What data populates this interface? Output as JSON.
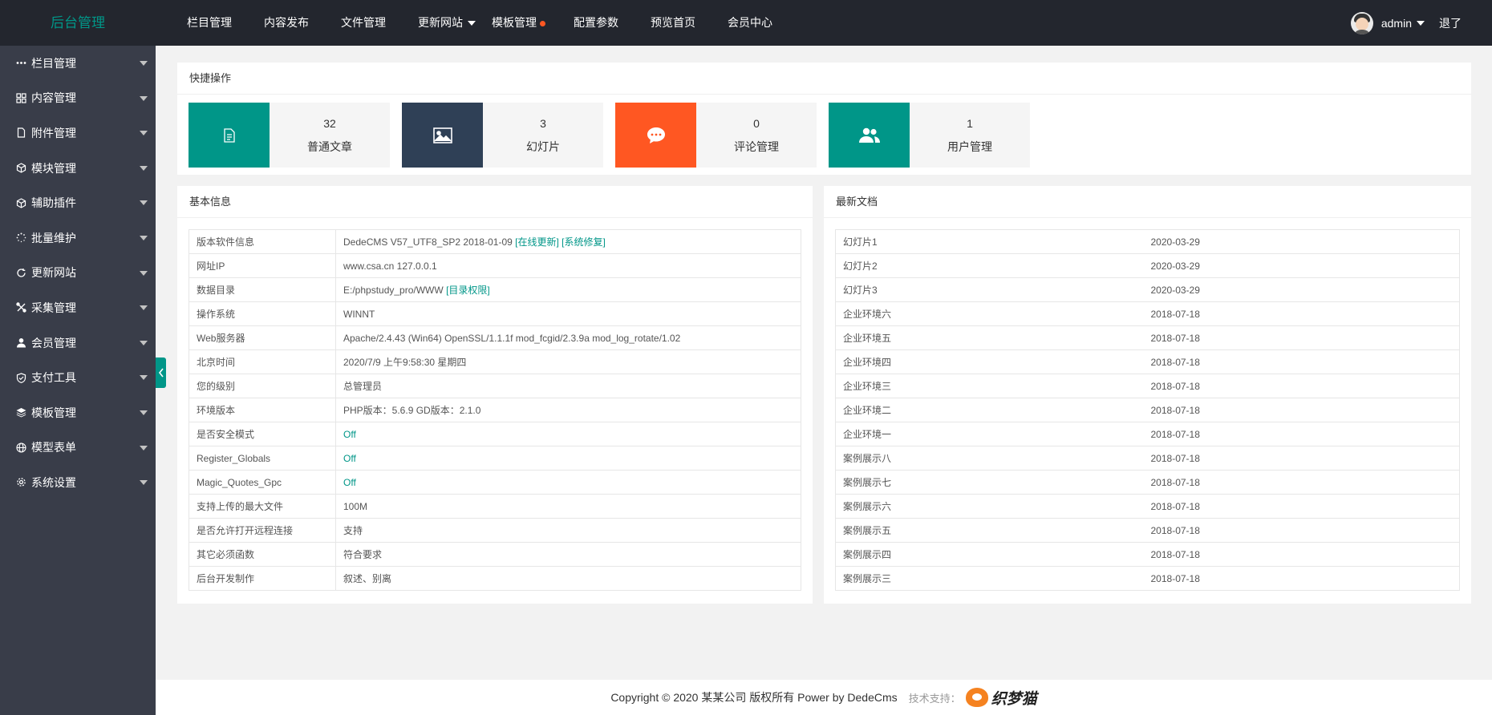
{
  "header": {
    "logo": "后台管理",
    "nav": [
      {
        "label": "栏目管理"
      },
      {
        "label": "内容发布"
      },
      {
        "label": "文件管理"
      },
      {
        "label": "更新网站"
      },
      {
        "label": "模板管理"
      },
      {
        "label": "配置参数"
      },
      {
        "label": "预览首页"
      },
      {
        "label": "会员中心"
      }
    ],
    "user": "admin",
    "logout": "退了"
  },
  "sidebar": {
    "items": [
      {
        "label": "栏目管理",
        "icon": "more-dots-icon"
      },
      {
        "label": "内容管理",
        "icon": "app-grid-icon"
      },
      {
        "label": "附件管理",
        "icon": "file-icon"
      },
      {
        "label": "模块管理",
        "icon": "cube-icon"
      },
      {
        "label": "辅助插件",
        "icon": "cube-icon"
      },
      {
        "label": "批量维护",
        "icon": "loading-icon"
      },
      {
        "label": "更新网站",
        "icon": "refresh-icon"
      },
      {
        "label": "采集管理",
        "icon": "tools-icon"
      },
      {
        "label": "会员管理",
        "icon": "user-icon"
      },
      {
        "label": "支付工具",
        "icon": "shield-check-icon"
      },
      {
        "label": "模板管理",
        "icon": "layers-icon"
      },
      {
        "label": "模型表单",
        "icon": "globe-icon"
      },
      {
        "label": "系统设置",
        "icon": "gear-icon"
      }
    ]
  },
  "quick": {
    "title": "快捷操作",
    "cards": [
      {
        "count": "32",
        "label": "普通文章",
        "color": "#009688",
        "icon": "document-icon"
      },
      {
        "count": "3",
        "label": "幻灯片",
        "color": "#2f4056",
        "icon": "image-icon"
      },
      {
        "count": "0",
        "label": "评论管理",
        "color": "#ff5722",
        "icon": "chat-icon"
      },
      {
        "count": "1",
        "label": "用户管理",
        "color": "#009688",
        "icon": "users-icon"
      }
    ]
  },
  "info": {
    "title": "基本信息",
    "rows": [
      {
        "key": "版本软件信息",
        "value": "DedeCMS V57_UTF8_SP2 2018-01-09",
        "link1": "[在线更新]",
        "link2": "[系统修复]"
      },
      {
        "key": "网址IP",
        "value": "www.csa.cn 127.0.0.1"
      },
      {
        "key": "数据目录",
        "value": "E:/phpstudy_pro/WWW",
        "link1": "[目录权限]"
      },
      {
        "key": "操作系统",
        "value": "WINNT"
      },
      {
        "key": "Web服务器",
        "value": "Apache/2.4.43 (Win64) OpenSSL/1.1.1f mod_fcgid/2.3.9a mod_log_rotate/1.02"
      },
      {
        "key": "北京时间",
        "value": "2020/7/9 上午9:58:30 星期四"
      },
      {
        "key": "您的级别",
        "value": "总管理员"
      },
      {
        "key": "环境版本",
        "value": "PHP版本：5.6.9 GD版本：2.1.0"
      },
      {
        "key": "是否安全模式",
        "value": "Off",
        "green": true
      },
      {
        "key": "Register_Globals",
        "value": "Off",
        "green": true
      },
      {
        "key": "Magic_Quotes_Gpc",
        "value": "Off",
        "green": true
      },
      {
        "key": "支持上传的最大文件",
        "value": "100M"
      },
      {
        "key": "是否允许打开远程连接",
        "value": "支持"
      },
      {
        "key": "其它必须函数",
        "value": "符合要求"
      },
      {
        "key": "后台开发制作",
        "value": "叙述、别离"
      }
    ]
  },
  "latest": {
    "title": "最新文档",
    "rows": [
      {
        "title": "幻灯片1",
        "date": "2020-03-29"
      },
      {
        "title": "幻灯片2",
        "date": "2020-03-29"
      },
      {
        "title": "幻灯片3",
        "date": "2020-03-29"
      },
      {
        "title": "企业环境六",
        "date": "2018-07-18"
      },
      {
        "title": "企业环境五",
        "date": "2018-07-18"
      },
      {
        "title": "企业环境四",
        "date": "2018-07-18"
      },
      {
        "title": "企业环境三",
        "date": "2018-07-18"
      },
      {
        "title": "企业环境二",
        "date": "2018-07-18"
      },
      {
        "title": "企业环境一",
        "date": "2018-07-18"
      },
      {
        "title": "案例展示八",
        "date": "2018-07-18"
      },
      {
        "title": "案例展示七",
        "date": "2018-07-18"
      },
      {
        "title": "案例展示六",
        "date": "2018-07-18"
      },
      {
        "title": "案例展示五",
        "date": "2018-07-18"
      },
      {
        "title": "案例展示四",
        "date": "2018-07-18"
      },
      {
        "title": "案例展示三",
        "date": "2018-07-18"
      }
    ]
  },
  "footer": {
    "copyright": "Copyright © 2020 某某公司 版权所有 Power by DedeCms",
    "tech": "技术支持：",
    "brand": "织梦猫"
  }
}
